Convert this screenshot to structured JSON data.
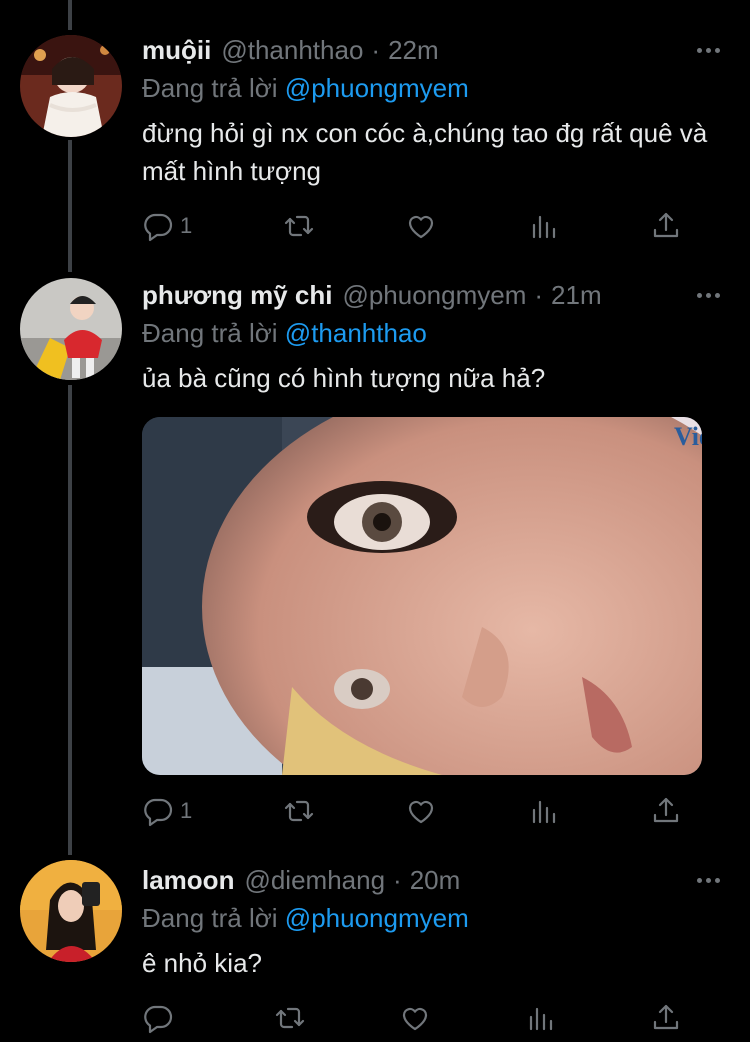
{
  "tweets": [
    {
      "name": "muộii",
      "handle": "@thanhthao",
      "time": "22m",
      "reply_prefix": "Đang trả lời",
      "reply_to": "@phuongmyem",
      "text": "đừng hỏi gì nx con cóc à,chúng tao đg rất quê và mất hình tượng",
      "reply_count": "1"
    },
    {
      "name": "phương mỹ chi",
      "handle": "@phuongmyem",
      "time": "21m",
      "reply_prefix": "Đang trả lời",
      "reply_to": "@thanhthao",
      "text": "ủa bà cũng có hình tượng nữa hả?",
      "reply_count": "1",
      "media_watermark": "Vie"
    },
    {
      "name": "lamoon",
      "handle": "@diemhang",
      "time": "20m",
      "reply_prefix": "Đang trả lời",
      "reply_to": "@phuongmyem",
      "text": "ê nhỏ kia?",
      "reply_count": ""
    }
  ],
  "colors": {
    "background": "#000000",
    "text": "#e7e9ea",
    "secondary": "#71767b",
    "link": "#1d9bf0",
    "thread_line": "#3d4146"
  },
  "icons": [
    "reply-icon",
    "retweet-icon",
    "like-icon",
    "views-icon",
    "share-icon",
    "more-icon"
  ]
}
